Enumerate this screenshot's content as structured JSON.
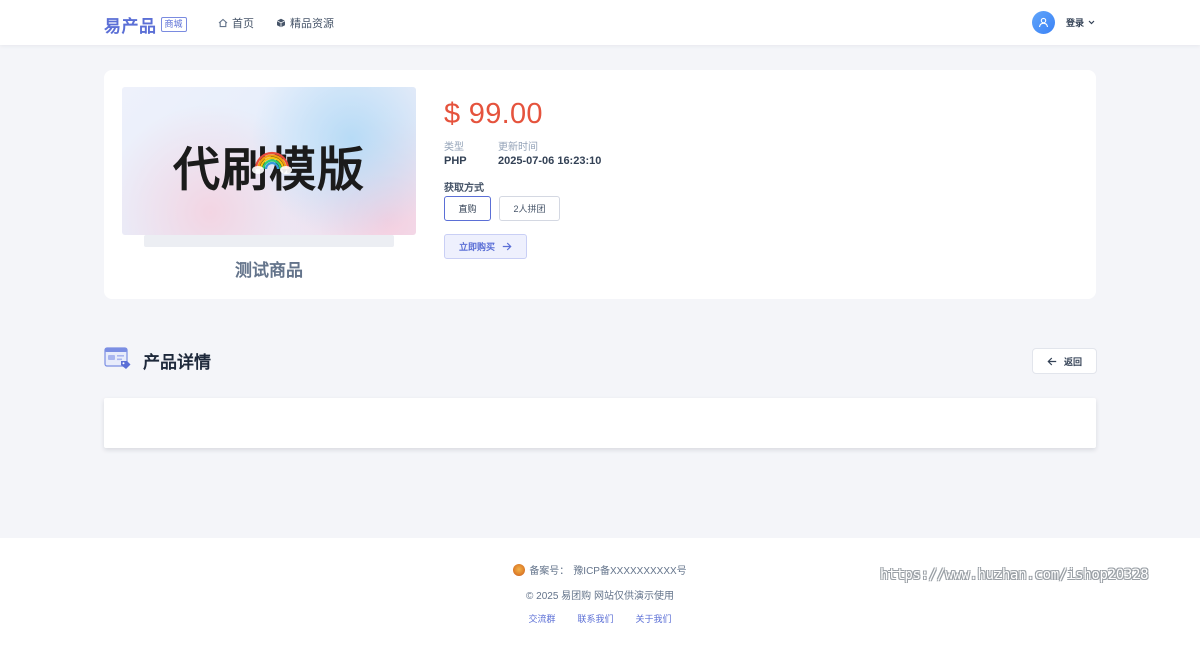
{
  "header": {
    "logo_text": "易产品",
    "logo_tag": "商城",
    "nav": [
      {
        "label": "首页",
        "icon": "home-icon"
      },
      {
        "label": "精品资源",
        "icon": "cube-icon"
      }
    ],
    "login_label": "登录"
  },
  "product": {
    "image_text": "代刷模版",
    "name": "测试商品",
    "price": "$ 99.00",
    "type_label": "类型",
    "type_value": "PHP",
    "updated_label": "更新时间",
    "updated_value": "2025-07-06 16:23:10",
    "method_label": "获取方式",
    "options": [
      "直购",
      "2人拼团"
    ],
    "selected_option": "直购",
    "buy_label": "立即购买"
  },
  "details": {
    "title": "产品详情",
    "back_label": "返回"
  },
  "footer": {
    "icp_label": "备案号：",
    "icp_value": "豫ICP备XXXXXXXXXX号",
    "copyright": "© 2025 易团购 网站仅供演示使用",
    "links": [
      "交流群",
      "联系我们",
      "关于我们"
    ],
    "watermark": "https://www.huzhan.com/ishop20328"
  },
  "colors": {
    "accent": "#5b6fd6",
    "price": "#e5533d",
    "background": "#f4f5f9"
  }
}
